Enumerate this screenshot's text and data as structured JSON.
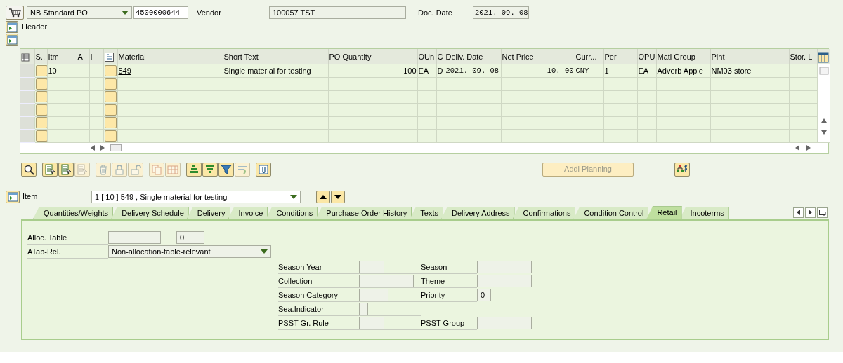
{
  "top_bar": {
    "doc_type": "NB Standard PO",
    "po_number": "4500000644",
    "vendor_label": "Vendor",
    "vendor": "100057 TST",
    "doc_date_label": "Doc. Date",
    "doc_date": "2021. 09. 08"
  },
  "header_section": {
    "label": "Header"
  },
  "items_table": {
    "columns": [
      "S..",
      "Itm",
      "A",
      "I",
      "Material",
      "Short Text",
      "PO Quantity",
      "OUn",
      "C",
      "Deliv. Date",
      "Net Price",
      "Curr...",
      "Per",
      "OPU",
      "Matl Group",
      "Plnt",
      "Stor. L"
    ],
    "rows": [
      {
        "item": "10",
        "material": "549",
        "short_text": "Single material for testing",
        "po_quantity": "100",
        "order_unit": "EA",
        "c": "D",
        "delivery_date": "2021. 09. 08",
        "net_price": "10. 00",
        "currency": "CNY",
        "per": "1",
        "opu": "EA",
        "material_group": "Adverb Apple",
        "plant": "NM03 store"
      }
    ]
  },
  "toolbar": [
    {
      "buttons": [
        {
          "kind": "details",
          "disabled": false
        }
      ]
    },
    {
      "buttons": [
        {
          "kind": "select-all",
          "disabled": false
        },
        {
          "kind": "select-block",
          "disabled": false
        },
        {
          "kind": "deselect",
          "disabled": true
        }
      ]
    },
    {
      "buttons": [
        {
          "kind": "delete",
          "disabled": true
        },
        {
          "kind": "lock",
          "disabled": true
        },
        {
          "kind": "unlock",
          "disabled": true
        }
      ]
    },
    {
      "buttons": [
        {
          "kind": "copy",
          "disabled": true
        },
        {
          "kind": "insert",
          "disabled": true
        }
      ]
    },
    {
      "buttons": [
        {
          "kind": "sort-asc",
          "disabled": false
        },
        {
          "kind": "sort-desc",
          "disabled": false
        },
        {
          "kind": "filter",
          "disabled": false
        },
        {
          "kind": "total",
          "disabled": true
        }
      ]
    },
    {
      "buttons": [
        {
          "kind": "attach",
          "disabled": false
        }
      ]
    }
  ],
  "addl_planning_button": {
    "label": "Addl Planning",
    "disabled": true
  },
  "item_selector": {
    "label": "Item",
    "value": "1 [ 10 ] 549 , Single material for testing"
  },
  "tabs": [
    {
      "label": "Quantities/Weights",
      "selected": false
    },
    {
      "label": "Delivery Schedule",
      "selected": false
    },
    {
      "label": "Delivery",
      "selected": false
    },
    {
      "label": "Invoice",
      "selected": false
    },
    {
      "label": "Conditions",
      "selected": false
    },
    {
      "label": "Purchase Order History",
      "selected": false
    },
    {
      "label": "Texts",
      "selected": false
    },
    {
      "label": "Delivery Address",
      "selected": false
    },
    {
      "label": "Confirmations",
      "selected": false
    },
    {
      "label": "Condition Control",
      "selected": false
    },
    {
      "label": "Retail",
      "selected": true
    },
    {
      "label": "Incoterms",
      "selected": false
    }
  ],
  "retail": {
    "alloc_table": {
      "label": "Alloc. Table",
      "value": "0"
    },
    "atab_rel": {
      "label": "ATab-Rel.",
      "value": "Non-allocation-table-relevant"
    },
    "rows": [
      {
        "left": {
          "label": "Season Year"
        },
        "right": {
          "label": "Season"
        }
      },
      {
        "left": {
          "label": "Collection"
        },
        "right": {
          "label": "Theme"
        }
      },
      {
        "left": {
          "label": "Season Category"
        },
        "right": {
          "label": "Priority",
          "value": "0"
        }
      },
      {
        "left": {
          "label": "Sea.Indicator"
        }
      },
      {
        "left": {
          "label": "PSST Gr. Rule"
        },
        "right": {
          "label": "PSST Group"
        }
      }
    ]
  }
}
